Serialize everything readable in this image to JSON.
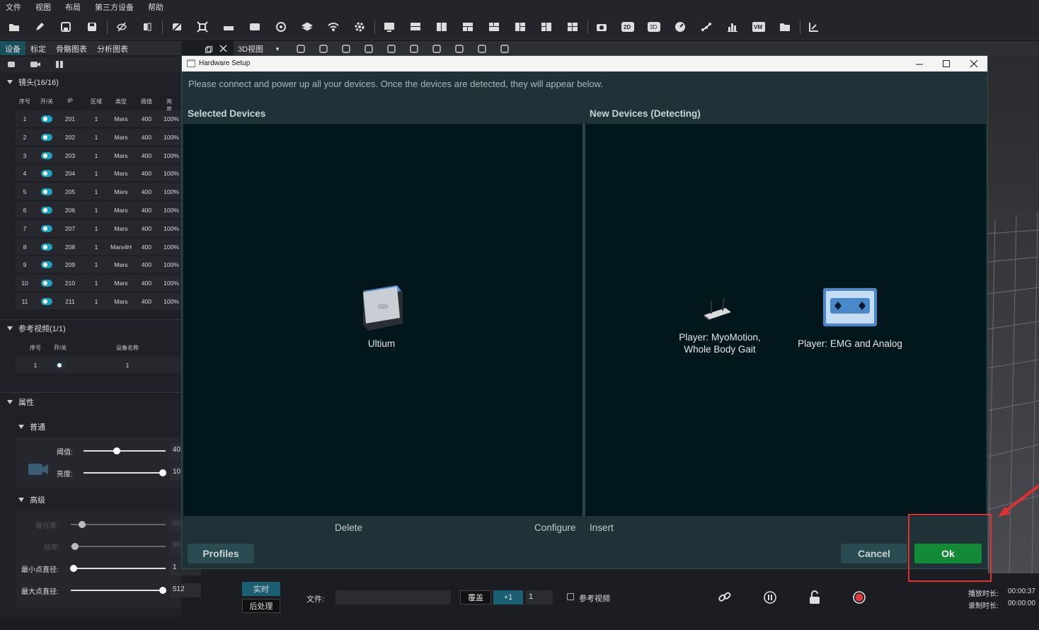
{
  "menu": {
    "items": [
      "文件",
      "视图",
      "布局",
      "第三方设备",
      "帮助"
    ]
  },
  "left": {
    "tabs": [
      "设备",
      "标定",
      "骨骼图表",
      "分析图表"
    ],
    "cameras": {
      "title": "镜头(16/16)",
      "columns": [
        "序号",
        "开/关",
        "IP",
        "区域",
        "类型",
        "阈值",
        "亮度"
      ],
      "rows": [
        [
          "1",
          "201",
          "1",
          "Mars",
          "400",
          "100%"
        ],
        [
          "2",
          "202",
          "1",
          "Mars",
          "400",
          "100%"
        ],
        [
          "3",
          "203",
          "1",
          "Mars",
          "400",
          "100%"
        ],
        [
          "4",
          "204",
          "1",
          "Mars",
          "400",
          "100%"
        ],
        [
          "5",
          "205",
          "1",
          "Mars",
          "400",
          "100%"
        ],
        [
          "6",
          "206",
          "1",
          "Mars",
          "400",
          "100%"
        ],
        [
          "7",
          "207",
          "1",
          "Mars",
          "400",
          "100%"
        ],
        [
          "8",
          "208",
          "1",
          "Mars4H",
          "400",
          "100%"
        ],
        [
          "9",
          "209",
          "1",
          "Mars",
          "400",
          "100%"
        ],
        [
          "10",
          "210",
          "1",
          "Mars",
          "400",
          "100%"
        ],
        [
          "11",
          "211",
          "1",
          "Mars",
          "400",
          "100%"
        ]
      ]
    },
    "refvideo": {
      "title": "参考视频(1/1)",
      "columns": [
        "序号",
        "开/关",
        "设备名称"
      ],
      "row": [
        "1",
        "1"
      ]
    },
    "props": {
      "title": "属性",
      "general": "普通",
      "threshold_label": "阈值:",
      "threshold_value": "40",
      "brightness_label": "亮度:",
      "brightness_value": "10",
      "advanced": "高级",
      "exposure_label": "曝光率:",
      "exposure_value": "10",
      "framerate_label": "帧率:",
      "framerate_value": "90",
      "min_diam_label": "最小点直径:",
      "min_diam_value": "1",
      "max_diam_label": "最大点直径:",
      "max_diam_value": "512"
    }
  },
  "view": {
    "dropdown": "3D视图"
  },
  "dialog": {
    "title": "Hardware Setup",
    "message": "Please connect and power up all your devices. Once the devices are detected, they will appear below.",
    "selected_header": "Selected Devices",
    "new_header": "New Devices (Detecting)",
    "selected_devices": [
      "Ultium"
    ],
    "new_devices": [
      "Player: MyoMotion,\nWhole Body Gait",
      "Player: EMG and Analog"
    ],
    "actions": {
      "delete": "Delete",
      "configure": "Configure",
      "insert": "Insert"
    },
    "buttons": {
      "profiles": "Profiles",
      "cancel": "Cancel",
      "ok": "Ok"
    }
  },
  "bottom": {
    "realtime": "实时",
    "postprocess": "后处理",
    "file_label": "文件:",
    "overwrite": "覆盖",
    "plus_one": "+1",
    "count": "1",
    "refvideo_check": "参考视频",
    "play_time_label": "播放时长:",
    "play_time": "00:00:37",
    "record_time_label": "录制时长:",
    "record_time": "00:00:00"
  },
  "colors": {
    "accent": "#1fa0c0",
    "ok_green": "#138a36",
    "annotation_red": "#e03131",
    "dialog_bg": "#1f3238",
    "pane_bg": "#01171c"
  }
}
